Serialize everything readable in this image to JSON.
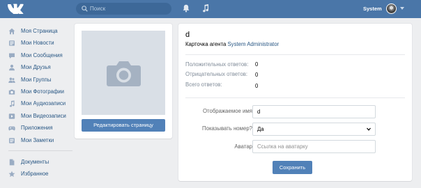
{
  "colors": {
    "header": "#4a76a8",
    "accent": "#5181b8",
    "link": "#2a5885",
    "background": "#edeef0"
  },
  "header": {
    "search_placeholder": "Поиск",
    "username": "System",
    "icons": [
      "vk-logo-icon",
      "search-icon",
      "bell-icon",
      "music-note-icon",
      "avatar",
      "chevron-down-icon"
    ]
  },
  "sidebar": {
    "items": [
      {
        "label": "Моя Страница",
        "icon": "home-icon"
      },
      {
        "label": "Мои Новости",
        "icon": "news-icon"
      },
      {
        "label": "Мои Сообщения",
        "icon": "messages-icon"
      },
      {
        "label": "Мои Друзья",
        "icon": "friend-icon"
      },
      {
        "label": "Мои Группы",
        "icon": "group-icon"
      },
      {
        "label": "Мои Фотографии",
        "icon": "camera-icon"
      },
      {
        "label": "Мои Аудиозаписи",
        "icon": "music-icon"
      },
      {
        "label": "Мои Видеозаписи",
        "icon": "video-icon"
      },
      {
        "label": "Приложения",
        "icon": "gamepad-icon"
      },
      {
        "label": "Мои Заметки",
        "icon": "notes-icon"
      }
    ],
    "extra": [
      {
        "label": "Документы",
        "icon": "document-icon"
      },
      {
        "label": "Избранное",
        "icon": "star-icon"
      }
    ]
  },
  "profile": {
    "edit_button": "Редактировать страницу"
  },
  "main": {
    "name": "d",
    "agent_card_prefix": "Карточка агента",
    "agent_link": "System Administrator",
    "stats": [
      {
        "label": "Положительных ответов:",
        "value": "0"
      },
      {
        "label": "Отрицательных ответов:",
        "value": "0"
      },
      {
        "label": "Всего ответов:",
        "value": "0"
      }
    ],
    "form": {
      "display_name_label": "Отображаемое имя",
      "display_name_value": "d",
      "show_number_label": "Показывать номер?",
      "show_number_value": "Да",
      "avatar_label": "Аватар",
      "avatar_placeholder": "Ссылка на аватарку",
      "save_button": "Сохранить"
    }
  }
}
